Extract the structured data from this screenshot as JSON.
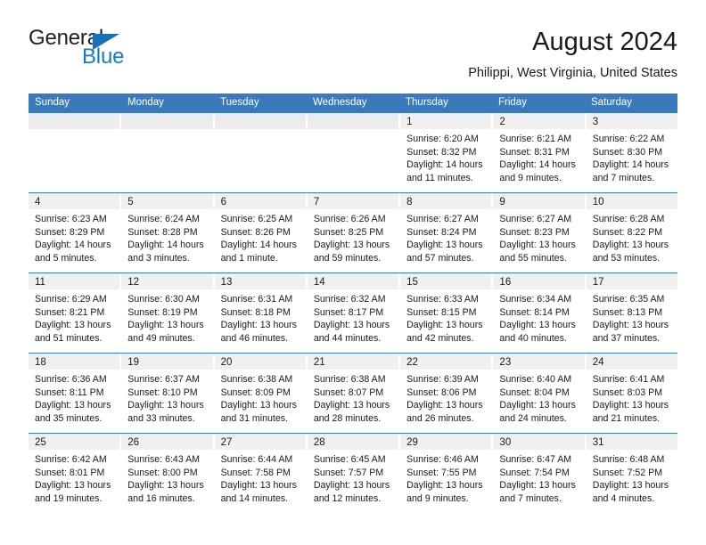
{
  "brand": {
    "name_part1": "General",
    "name_part2": "Blue",
    "accent_color": "#1a7ac4",
    "triangle_color": "#1a6fb5"
  },
  "header": {
    "title": "August 2024",
    "subtitle": "Philippi, West Virginia, United States"
  },
  "calendar": {
    "header_bg": "#3a79ba",
    "daynum_bg": "#f0f0f0",
    "weekdays": [
      "Sunday",
      "Monday",
      "Tuesday",
      "Wednesday",
      "Thursday",
      "Friday",
      "Saturday"
    ],
    "weeks": [
      [
        {
          "day": "",
          "empty": true,
          "lines": []
        },
        {
          "day": "",
          "empty": true,
          "lines": []
        },
        {
          "day": "",
          "empty": true,
          "lines": []
        },
        {
          "day": "",
          "empty": true,
          "lines": []
        },
        {
          "day": "1",
          "empty": false,
          "lines": [
            "Sunrise: 6:20 AM",
            "Sunset: 8:32 PM",
            "Daylight: 14 hours",
            "and 11 minutes."
          ]
        },
        {
          "day": "2",
          "empty": false,
          "lines": [
            "Sunrise: 6:21 AM",
            "Sunset: 8:31 PM",
            "Daylight: 14 hours",
            "and 9 minutes."
          ]
        },
        {
          "day": "3",
          "empty": false,
          "lines": [
            "Sunrise: 6:22 AM",
            "Sunset: 8:30 PM",
            "Daylight: 14 hours",
            "and 7 minutes."
          ]
        }
      ],
      [
        {
          "day": "4",
          "empty": false,
          "lines": [
            "Sunrise: 6:23 AM",
            "Sunset: 8:29 PM",
            "Daylight: 14 hours",
            "and 5 minutes."
          ]
        },
        {
          "day": "5",
          "empty": false,
          "lines": [
            "Sunrise: 6:24 AM",
            "Sunset: 8:28 PM",
            "Daylight: 14 hours",
            "and 3 minutes."
          ]
        },
        {
          "day": "6",
          "empty": false,
          "lines": [
            "Sunrise: 6:25 AM",
            "Sunset: 8:26 PM",
            "Daylight: 14 hours",
            "and 1 minute."
          ]
        },
        {
          "day": "7",
          "empty": false,
          "lines": [
            "Sunrise: 6:26 AM",
            "Sunset: 8:25 PM",
            "Daylight: 13 hours",
            "and 59 minutes."
          ]
        },
        {
          "day": "8",
          "empty": false,
          "lines": [
            "Sunrise: 6:27 AM",
            "Sunset: 8:24 PM",
            "Daylight: 13 hours",
            "and 57 minutes."
          ]
        },
        {
          "day": "9",
          "empty": false,
          "lines": [
            "Sunrise: 6:27 AM",
            "Sunset: 8:23 PM",
            "Daylight: 13 hours",
            "and 55 minutes."
          ]
        },
        {
          "day": "10",
          "empty": false,
          "lines": [
            "Sunrise: 6:28 AM",
            "Sunset: 8:22 PM",
            "Daylight: 13 hours",
            "and 53 minutes."
          ]
        }
      ],
      [
        {
          "day": "11",
          "empty": false,
          "lines": [
            "Sunrise: 6:29 AM",
            "Sunset: 8:21 PM",
            "Daylight: 13 hours",
            "and 51 minutes."
          ]
        },
        {
          "day": "12",
          "empty": false,
          "lines": [
            "Sunrise: 6:30 AM",
            "Sunset: 8:19 PM",
            "Daylight: 13 hours",
            "and 49 minutes."
          ]
        },
        {
          "day": "13",
          "empty": false,
          "lines": [
            "Sunrise: 6:31 AM",
            "Sunset: 8:18 PM",
            "Daylight: 13 hours",
            "and 46 minutes."
          ]
        },
        {
          "day": "14",
          "empty": false,
          "lines": [
            "Sunrise: 6:32 AM",
            "Sunset: 8:17 PM",
            "Daylight: 13 hours",
            "and 44 minutes."
          ]
        },
        {
          "day": "15",
          "empty": false,
          "lines": [
            "Sunrise: 6:33 AM",
            "Sunset: 8:15 PM",
            "Daylight: 13 hours",
            "and 42 minutes."
          ]
        },
        {
          "day": "16",
          "empty": false,
          "lines": [
            "Sunrise: 6:34 AM",
            "Sunset: 8:14 PM",
            "Daylight: 13 hours",
            "and 40 minutes."
          ]
        },
        {
          "day": "17",
          "empty": false,
          "lines": [
            "Sunrise: 6:35 AM",
            "Sunset: 8:13 PM",
            "Daylight: 13 hours",
            "and 37 minutes."
          ]
        }
      ],
      [
        {
          "day": "18",
          "empty": false,
          "lines": [
            "Sunrise: 6:36 AM",
            "Sunset: 8:11 PM",
            "Daylight: 13 hours",
            "and 35 minutes."
          ]
        },
        {
          "day": "19",
          "empty": false,
          "lines": [
            "Sunrise: 6:37 AM",
            "Sunset: 8:10 PM",
            "Daylight: 13 hours",
            "and 33 minutes."
          ]
        },
        {
          "day": "20",
          "empty": false,
          "lines": [
            "Sunrise: 6:38 AM",
            "Sunset: 8:09 PM",
            "Daylight: 13 hours",
            "and 31 minutes."
          ]
        },
        {
          "day": "21",
          "empty": false,
          "lines": [
            "Sunrise: 6:38 AM",
            "Sunset: 8:07 PM",
            "Daylight: 13 hours",
            "and 28 minutes."
          ]
        },
        {
          "day": "22",
          "empty": false,
          "lines": [
            "Sunrise: 6:39 AM",
            "Sunset: 8:06 PM",
            "Daylight: 13 hours",
            "and 26 minutes."
          ]
        },
        {
          "day": "23",
          "empty": false,
          "lines": [
            "Sunrise: 6:40 AM",
            "Sunset: 8:04 PM",
            "Daylight: 13 hours",
            "and 24 minutes."
          ]
        },
        {
          "day": "24",
          "empty": false,
          "lines": [
            "Sunrise: 6:41 AM",
            "Sunset: 8:03 PM",
            "Daylight: 13 hours",
            "and 21 minutes."
          ]
        }
      ],
      [
        {
          "day": "25",
          "empty": false,
          "lines": [
            "Sunrise: 6:42 AM",
            "Sunset: 8:01 PM",
            "Daylight: 13 hours",
            "and 19 minutes."
          ]
        },
        {
          "day": "26",
          "empty": false,
          "lines": [
            "Sunrise: 6:43 AM",
            "Sunset: 8:00 PM",
            "Daylight: 13 hours",
            "and 16 minutes."
          ]
        },
        {
          "day": "27",
          "empty": false,
          "lines": [
            "Sunrise: 6:44 AM",
            "Sunset: 7:58 PM",
            "Daylight: 13 hours",
            "and 14 minutes."
          ]
        },
        {
          "day": "28",
          "empty": false,
          "lines": [
            "Sunrise: 6:45 AM",
            "Sunset: 7:57 PM",
            "Daylight: 13 hours",
            "and 12 minutes."
          ]
        },
        {
          "day": "29",
          "empty": false,
          "lines": [
            "Sunrise: 6:46 AM",
            "Sunset: 7:55 PM",
            "Daylight: 13 hours",
            "and 9 minutes."
          ]
        },
        {
          "day": "30",
          "empty": false,
          "lines": [
            "Sunrise: 6:47 AM",
            "Sunset: 7:54 PM",
            "Daylight: 13 hours",
            "and 7 minutes."
          ]
        },
        {
          "day": "31",
          "empty": false,
          "lines": [
            "Sunrise: 6:48 AM",
            "Sunset: 7:52 PM",
            "Daylight: 13 hours",
            "and 4 minutes."
          ]
        }
      ]
    ]
  }
}
